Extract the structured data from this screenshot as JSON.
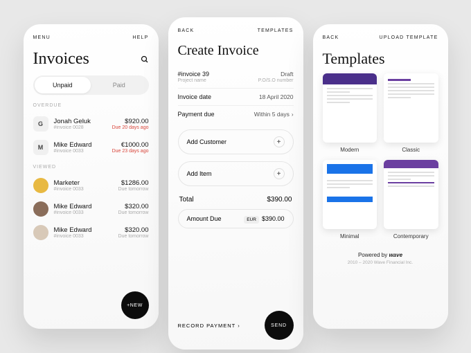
{
  "colors": {
    "accent_red": "#d9453a",
    "purple": "#4a2f8a",
    "blue": "#1a73e8",
    "violet": "#6b3fa0"
  },
  "screen1": {
    "top": {
      "left": "MENU",
      "right": "HELP"
    },
    "title": "Invoices",
    "tabs": {
      "unpaid": "Unpaid",
      "paid": "Paid"
    },
    "sections": {
      "overdue": {
        "label": "OVERDUE",
        "items": [
          {
            "avatar": "G",
            "name": "Jonah Geluk",
            "ref": "#invoice 0028",
            "amount": "$920.00",
            "due": "Due 20 days ago"
          },
          {
            "avatar": "M",
            "name": "Mike Edward",
            "ref": "#invoice 0033",
            "amount": "€1000.00",
            "due": "Due 23 days ago"
          }
        ]
      },
      "viewed": {
        "label": "VIEWED",
        "items": [
          {
            "name": "Marketer",
            "ref": "#invoice 0033",
            "amount": "$1286.00",
            "due": "Due tomorrow"
          },
          {
            "name": "Mike Edward",
            "ref": "#invoice 0033",
            "amount": "$320.00",
            "due": "Due tomorrow"
          },
          {
            "name": "Mike Edward",
            "ref": "#invoice 0033",
            "amount": "$320.00",
            "due": "Due tomorrow"
          }
        ]
      }
    },
    "fab": "+NEW"
  },
  "screen2": {
    "top": {
      "left": "BACK",
      "right": "TEMPLATES"
    },
    "title": "Create Invoice",
    "rows": {
      "invoice": {
        "label": "#invoice 39",
        "sub": "Project name",
        "value": "Draft",
        "value_sub": "P.O/S.O number"
      },
      "date": {
        "label": "Invoice date",
        "value": "18 April 2020"
      },
      "payment": {
        "label": "Payment due",
        "value": "Within 5 days"
      }
    },
    "add_customer": "Add Customer",
    "add_item": "Add Item",
    "total": {
      "label": "Total",
      "value": "$390.00"
    },
    "amount_due": {
      "label": "Amount Due",
      "currency": "EUR",
      "value": "$390.00"
    },
    "record_payment": "RECORD PAYMENT",
    "send": "SEND"
  },
  "screen3": {
    "top": {
      "left": "BACK",
      "right": "UPLOAD TEMPLATE"
    },
    "title": "Templates",
    "templates": [
      {
        "name": "Modern"
      },
      {
        "name": "Classic"
      },
      {
        "name": "Minimal"
      },
      {
        "name": "Contemporary"
      }
    ],
    "powered": "Powered by",
    "brand": "wave",
    "copyright": "2010 – 2020 Wave Financial Inc."
  }
}
